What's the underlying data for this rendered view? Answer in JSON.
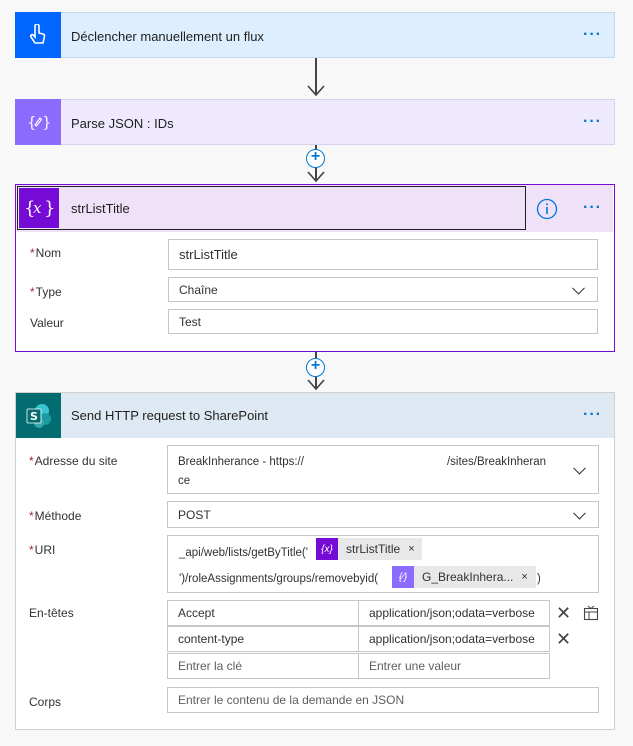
{
  "step1": {
    "title": "Déclencher manuellement un flux",
    "icon": "hand-touch-icon",
    "color": "#0066ff"
  },
  "step2": {
    "title": "Parse JSON : IDs",
    "icon": "json-edit-icon",
    "color": "#8c6cff"
  },
  "step3": {
    "title": "strListTitle",
    "icon": "variable-icon",
    "color": "#770bd6",
    "fields": {
      "name_label": "Nom",
      "name_value": "strListTitle",
      "type_label": "Type",
      "type_value": "Chaîne",
      "value_label": "Valeur",
      "value_value": "Test"
    }
  },
  "step4": {
    "title": "Send HTTP request to SharePoint",
    "icon": "sharepoint-icon",
    "color": "#036c70",
    "site_label": "Adresse du site",
    "site_value_line1": "BreakInherance - https://",
    "site_value_suffix": "/sites/BreakInheran",
    "site_value_line2": "ce",
    "method_label": "Méthode",
    "method_value": "POST",
    "uri_label": "URI",
    "uri_part1": "_api/web/lists/getByTitle('",
    "uri_token1": "strListTitle",
    "uri_part2": "')/roleAssignments/groups/removebyid(",
    "uri_token2": "G_BreakInhera...",
    "uri_part3": ")",
    "headers_label": "En-têtes",
    "headers": [
      {
        "key": "Accept",
        "value": "application/json;odata=verbose"
      },
      {
        "key": "content-type",
        "value": "application/json;odata=verbose"
      }
    ],
    "header_key_placeholder": "Entrer la clé",
    "header_value_placeholder": "Entrer une valeur",
    "body_label": "Corps",
    "body_placeholder": "Entrer le contenu de la demande en JSON"
  },
  "more_label": "···",
  "token_remove": "×",
  "row_remove": "✕"
}
